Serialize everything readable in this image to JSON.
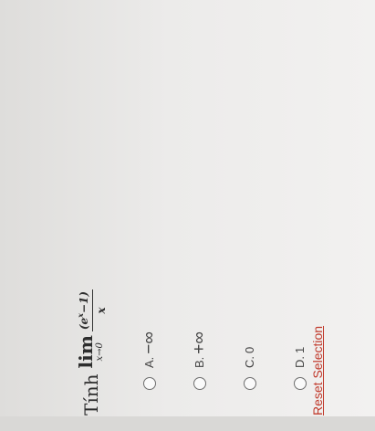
{
  "question": {
    "prefix": "Tính",
    "lim": "lim",
    "lim_sub": "x→0",
    "numerator_base": "(e",
    "numerator_exp": "x",
    "numerator_tail": "−1)",
    "denominator": "x"
  },
  "options": [
    {
      "key": "A.",
      "value": "−∞"
    },
    {
      "key": "B.",
      "value": "+∞"
    },
    {
      "key": "C.",
      "value": "0"
    },
    {
      "key": "D.",
      "value": "1"
    }
  ],
  "reset_label": "Reset Selection"
}
